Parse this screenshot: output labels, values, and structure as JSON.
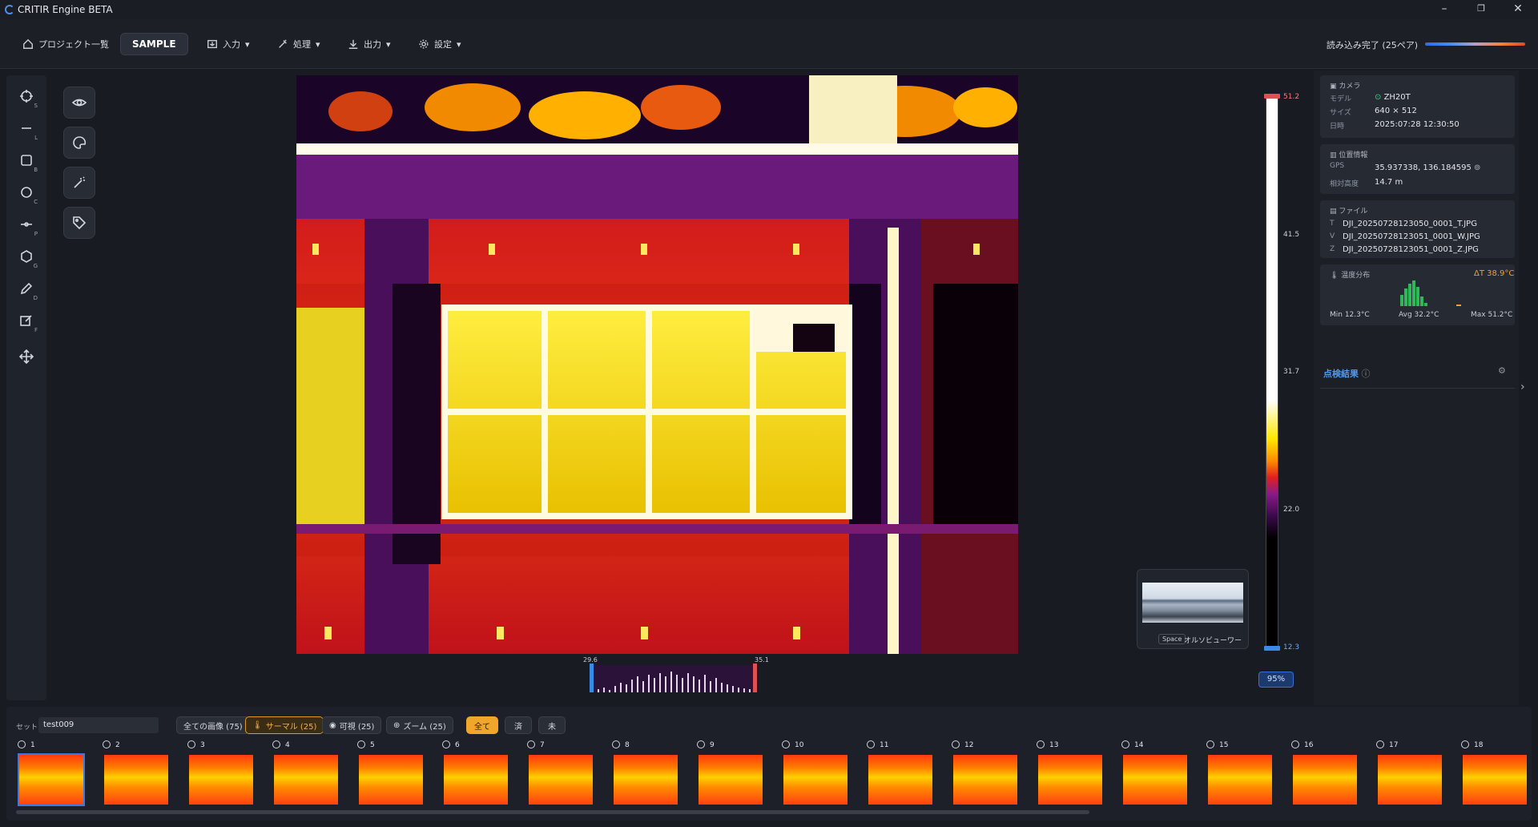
{
  "app": {
    "title": "CRITIR Engine BETA"
  },
  "toolbar": {
    "projects": "プロジェクト一覧",
    "sample": "SAMPLE",
    "input": "入力",
    "process": "処理",
    "output": "出力",
    "settings": "設定",
    "status": "読み込み完了 (25ペア)"
  },
  "tools": [
    {
      "key": "S"
    },
    {
      "key": "L"
    },
    {
      "key": "B"
    },
    {
      "key": "C"
    },
    {
      "key": "P"
    },
    {
      "key": "G"
    },
    {
      "key": "D"
    },
    {
      "key": "F"
    }
  ],
  "colorbar": {
    "max": "51.2",
    "t1": "41.5",
    "t2": "31.7",
    "t3": "22.0",
    "min": "12.3",
    "zoom": "95%"
  },
  "histogram": {
    "low": "29.6",
    "high": "35.1"
  },
  "ortho": {
    "key": "Space",
    "label": "オルソビューワー"
  },
  "camera": {
    "title": "カメラ",
    "model_label": "モデル",
    "model": "ZH20T",
    "size_label": "サイズ",
    "size": "640 × 512",
    "date_label": "日時",
    "date": "2025:07:28 12:30:50"
  },
  "location": {
    "title": "位置情報",
    "gps_label": "GPS",
    "gps": "35.937338, 136.184595",
    "alt_label": "相対高度",
    "alt": "14.7 m"
  },
  "files": {
    "title": "ファイル",
    "t_key": "T",
    "t": "DJI_20250728123050_0001_T.JPG",
    "v_key": "V",
    "v": "DJI_20250728123051_0001_W.JPG",
    "z_key": "Z",
    "z": "DJI_20250728123051_0001_Z.JPG"
  },
  "tempdist": {
    "title": "温度分布",
    "delta": "ΔT 38.9°C",
    "min": "Min 12.3°C",
    "avg": "Avg 32.2°C",
    "max": "Max 51.2°C"
  },
  "results": {
    "title": "点検結果"
  },
  "bottom": {
    "set_label": "セット:",
    "set_value": "test009",
    "all_images": "全ての画像 (75)",
    "thermal": "サーマル (25)",
    "visible": "可視 (25)",
    "zoom": "ズーム (25)",
    "all": "全て",
    "done": "済",
    "undone": "未"
  },
  "thumbs": [
    "1",
    "2",
    "3",
    "4",
    "5",
    "6",
    "7",
    "8",
    "9",
    "10",
    "11",
    "12",
    "13",
    "14",
    "15",
    "16",
    "17",
    "18"
  ]
}
